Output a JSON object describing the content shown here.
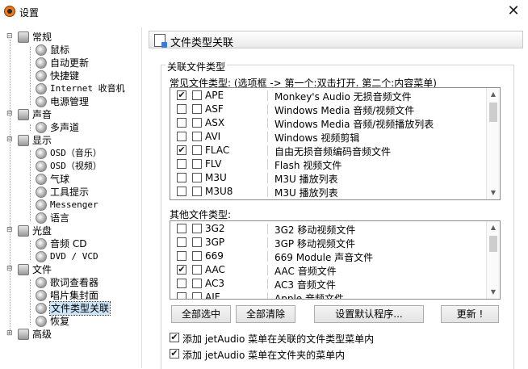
{
  "window": {
    "title": "设置",
    "close_symbol": "✕"
  },
  "tree": {
    "items": [
      {
        "label": "常规",
        "expander": "⊟"
      },
      {
        "label": "鼠标"
      },
      {
        "label": "自动更新"
      },
      {
        "label": "快捷键"
      },
      {
        "label": "Internet 收音机"
      },
      {
        "label": "电源管理"
      },
      {
        "label": "声音",
        "expander": "⊟"
      },
      {
        "label": "多声道"
      },
      {
        "label": "显示",
        "expander": "⊟"
      },
      {
        "label": "OSD（音乐）"
      },
      {
        "label": "OSD（视频）"
      },
      {
        "label": "气球"
      },
      {
        "label": "工具提示"
      },
      {
        "label": "Messenger"
      },
      {
        "label": "语言"
      },
      {
        "label": "光盘",
        "expander": "⊟"
      },
      {
        "label": "音频 CD"
      },
      {
        "label": "DVD / VCD"
      },
      {
        "label": "文件",
        "expander": "⊟"
      },
      {
        "label": "歌词查看器"
      },
      {
        "label": "唱片集封面"
      },
      {
        "label": "文件类型关联",
        "selected": true
      },
      {
        "label": "恢复"
      },
      {
        "label": "高级",
        "expander": "⊞"
      }
    ]
  },
  "panel": {
    "title": "文件类型关联",
    "group_title": "关联文件类型",
    "common_label": "常见文件类型: (选项框 -> 第一个:双击打开. 第二个:内容菜单)",
    "other_label": "其他文件类型:",
    "common_list": [
      {
        "ext": "APE",
        "desc": "Monkey's Audio 无损音频文件",
        "cb1": true,
        "cb2": false
      },
      {
        "ext": "ASF",
        "desc": "Windows Media 音频/视频文件",
        "cb1": false,
        "cb2": false
      },
      {
        "ext": "ASX",
        "desc": "Windows Media 音频/视频播放列表",
        "cb1": false,
        "cb2": false
      },
      {
        "ext": "AVI",
        "desc": "Windows 视频剪辑",
        "cb1": false,
        "cb2": false
      },
      {
        "ext": "FLAC",
        "desc": "自由无损音频编码音频文件",
        "cb1": true,
        "cb2": false
      },
      {
        "ext": "FLV",
        "desc": "Flash 视频文件",
        "cb1": false,
        "cb2": false
      },
      {
        "ext": "M3U",
        "desc": "M3U 播放列表",
        "cb1": false,
        "cb2": false
      },
      {
        "ext": "M3U8",
        "desc": "M3U 播放列表",
        "cb1": false,
        "cb2": false
      }
    ],
    "other_list": [
      {
        "ext": "3G2",
        "desc": "3G2 移动视频文件",
        "cb1": false,
        "cb2": false
      },
      {
        "ext": "3GP",
        "desc": "3GP 移动视频文件",
        "cb1": false,
        "cb2": false
      },
      {
        "ext": "669",
        "desc": "669 Module 声音文件",
        "cb1": false,
        "cb2": false
      },
      {
        "ext": "AAC",
        "desc": "AAC 音频文件",
        "cb1": true,
        "cb2": false
      },
      {
        "ext": "AC3",
        "desc": "AC3 音频文件",
        "cb1": false,
        "cb2": false
      },
      {
        "ext": "AIF",
        "desc": "Apple 音频文件",
        "cb1": false,
        "cb2": false
      }
    ],
    "buttons": {
      "select_all": "全部选中",
      "clear_all": "全部清除",
      "set_default": "设置默认程序...",
      "update": "更新 !"
    },
    "options": [
      {
        "label": "添加 jetAudio 菜单在关联的文件类型菜单内",
        "checked": true
      },
      {
        "label": "添加 jetAudio 菜单在文件夹的菜单内",
        "checked": true
      }
    ],
    "check_symbol": "✔",
    "scroll_up": "▲",
    "scroll_down": "▼"
  }
}
